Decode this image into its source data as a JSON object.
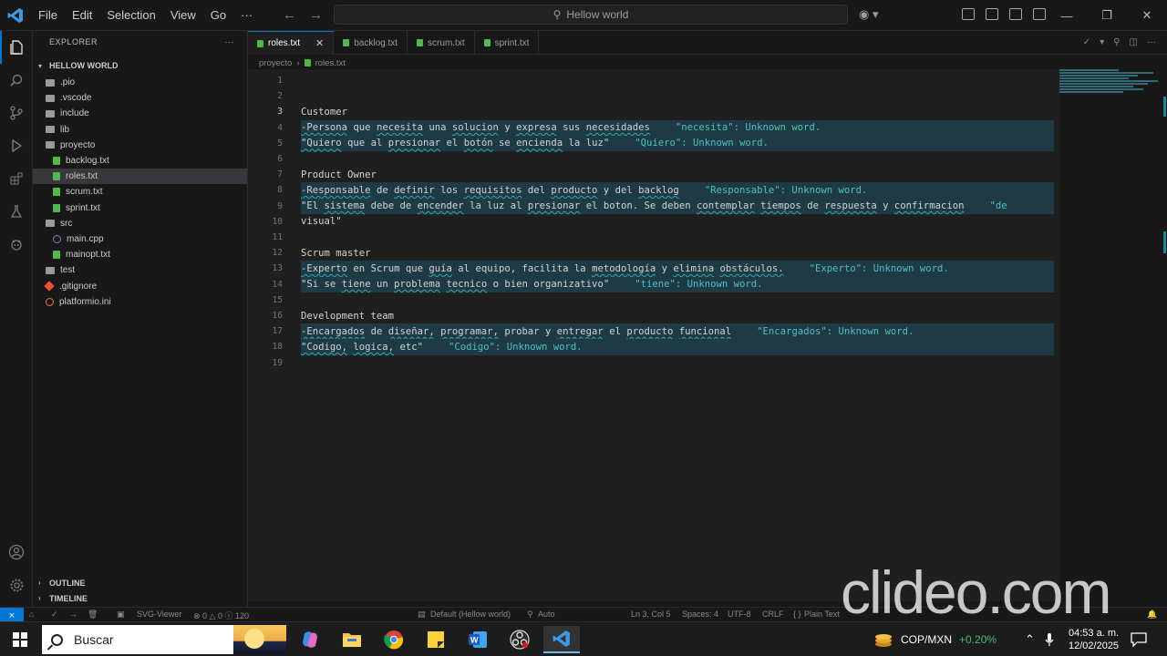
{
  "titlebar": {
    "menu": [
      "File",
      "Edit",
      "Selection",
      "View",
      "Go",
      "···"
    ],
    "search_text": "Hellow world"
  },
  "sidebar": {
    "header": "EXPLORER",
    "root": "HELLOW WORLD",
    "tree": [
      {
        "label": ".pio",
        "type": "folder",
        "depth": 1
      },
      {
        "label": ".vscode",
        "type": "folder",
        "depth": 1
      },
      {
        "label": "include",
        "type": "folder",
        "depth": 1
      },
      {
        "label": "lib",
        "type": "folder",
        "depth": 1
      },
      {
        "label": "proyecto",
        "type": "folder-open",
        "depth": 1
      },
      {
        "label": "backlog.txt",
        "type": "txt",
        "depth": 2
      },
      {
        "label": "roles.txt",
        "type": "txt",
        "depth": 2,
        "active": true
      },
      {
        "label": "scrum.txt",
        "type": "txt",
        "depth": 2
      },
      {
        "label": "sprint.txt",
        "type": "txt",
        "depth": 2
      },
      {
        "label": "src",
        "type": "folder-open",
        "depth": 1
      },
      {
        "label": "main.cpp",
        "type": "cpp",
        "depth": 2
      },
      {
        "label": "mainopt.txt",
        "type": "txt",
        "depth": 2
      },
      {
        "label": "test",
        "type": "folder",
        "depth": 1
      },
      {
        "label": ".gitignore",
        "type": "git",
        "depth": 1
      },
      {
        "label": "platformio.ini",
        "type": "ini",
        "depth": 1
      }
    ],
    "outline": "OUTLINE",
    "timeline": "TIMELINE"
  },
  "tabs": [
    {
      "label": "roles.txt",
      "active": true
    },
    {
      "label": "backlog.txt"
    },
    {
      "label": "scrum.txt"
    },
    {
      "label": "sprint.txt"
    }
  ],
  "breadcrumb": {
    "folder": "proyecto",
    "file": "roles.txt"
  },
  "editor": {
    "current_line": 3,
    "lines": [
      {
        "n": "1",
        "text": "",
        "hint": ""
      },
      {
        "n": "2",
        "text": "",
        "hint": ""
      },
      {
        "n": "3",
        "text": "Customer",
        "hint": ""
      },
      {
        "n": "4",
        "text": "-Persona que necesita una solucion y expresa sus necesidades",
        "hint": "\"necesita\": Unknown word.",
        "hl": true
      },
      {
        "n": "5",
        "text": "\"Quiero que al presionar el botón se encienda la luz\"",
        "hint": "\"Quiero\": Unknown word.",
        "hl": true
      },
      {
        "n": "6",
        "text": "",
        "hint": ""
      },
      {
        "n": "7",
        "text": "Product Owner",
        "hint": ""
      },
      {
        "n": "8",
        "text": "-Responsable de definir los requisitos del producto y del backlog",
        "hint": "\"Responsable\": Unknown word.",
        "hl": true
      },
      {
        "n": "9",
        "text": "\"El sistema debe de encender la luz al presionar el boton. Se deben contemplar tiempos de respuesta y confirmacion",
        "hint": "\"de",
        "hl": true
      },
      {
        "n": "10",
        "text": "visual\"",
        "hint": ""
      },
      {
        "n": "11",
        "text": "",
        "hint": ""
      },
      {
        "n": "12",
        "text": "Scrum master",
        "hint": ""
      },
      {
        "n": "13",
        "text": "-Experto en Scrum que guía al equipo, facilita la metodología y elimina obstáculos.",
        "hint": "\"Experto\": Unknown word.",
        "hl": true
      },
      {
        "n": "14",
        "text": "\"Si se tiene un problema tecnico o bien organizativo\"",
        "hint": "\"tiene\": Unknown word.",
        "hl": true
      },
      {
        "n": "15",
        "text": "",
        "hint": ""
      },
      {
        "n": "16",
        "text": "Development team",
        "hint": ""
      },
      {
        "n": "17",
        "text": "-Encargados de diseñar, programar, probar y entregar el producto funcional",
        "hint": "\"Encargados\": Unknown word.",
        "hl": true
      },
      {
        "n": "18",
        "text": "\"Codigo, logica, etc\"",
        "hint": "\"Codigo\": Unknown word.",
        "hl": true
      },
      {
        "n": "19",
        "text": "",
        "hint": ""
      }
    ]
  },
  "statusbar": {
    "svg_viewer": "SVG-Viewer",
    "problems": "⊗ 0 △ 0 ⓘ 120",
    "env": "Default (Hellow world)",
    "auto": "Auto",
    "position": "Ln 3, Col 5",
    "spaces": "Spaces: 4",
    "encoding": "UTF-8",
    "eol": "CRLF",
    "language": "Plain Text"
  },
  "watermark": "clideo.com",
  "taskbar": {
    "search_placeholder": "Buscar",
    "ticker": "COP/MXN",
    "ticker_change": "+0.20%",
    "time": "04:53 a. m.",
    "date": "12/02/2025"
  },
  "colors": {
    "accent": "#0078d4",
    "hint": "#4fc1c0",
    "diagnostic_band": "#1e3a44",
    "txt_icon": "#4fb94a",
    "ticker_up": "#3fbf6f"
  }
}
